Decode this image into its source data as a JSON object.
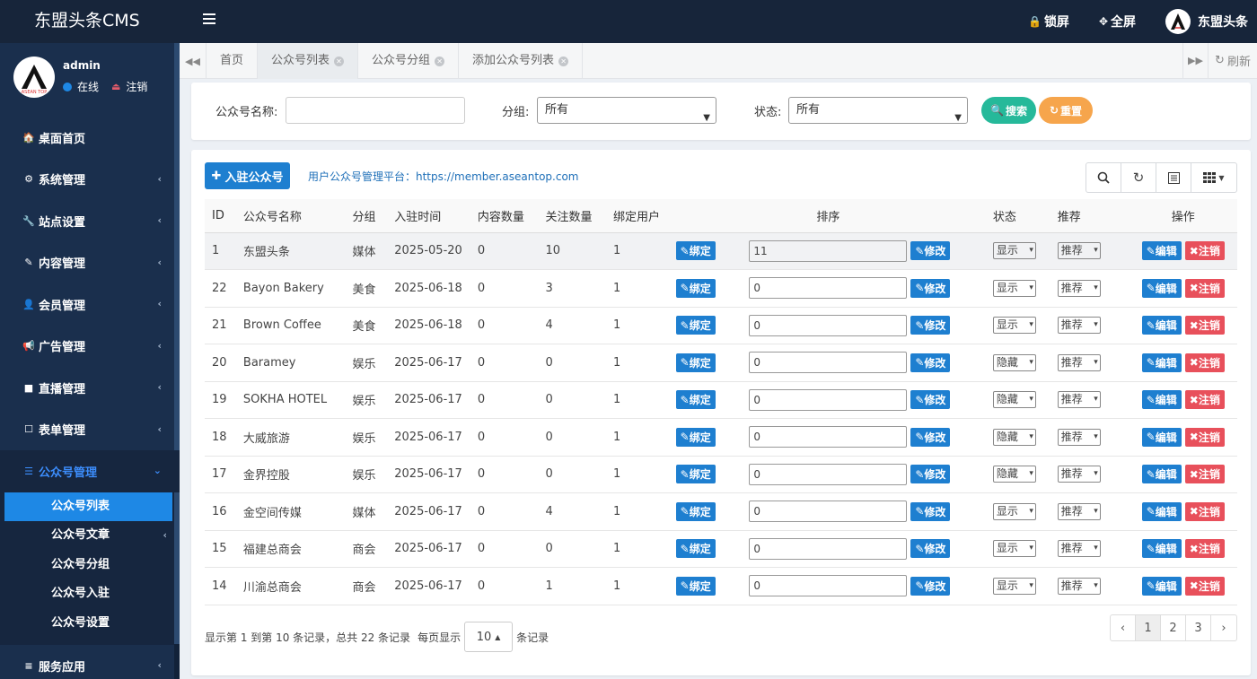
{
  "app": {
    "title": "东盟头条CMS"
  },
  "topbar": {
    "lock_label": "锁屏",
    "fullscreen_label": "全屏",
    "user_label": "东盟头条"
  },
  "user": {
    "name": "admin",
    "status": "在线",
    "logout": "注销"
  },
  "sidebar": {
    "items": [
      {
        "label": "桌面首页",
        "icon": "home-icon",
        "glyph": "🏠"
      },
      {
        "label": "系统管理",
        "icon": "gear-icon",
        "glyph": "⚙",
        "arrow": true
      },
      {
        "label": "站点设置",
        "icon": "wrench-icon",
        "glyph": "🔧",
        "arrow": true
      },
      {
        "label": "内容管理",
        "icon": "edit-icon",
        "glyph": "✎",
        "arrow": true
      },
      {
        "label": "会员管理",
        "icon": "user-icon",
        "glyph": "👤",
        "arrow": true
      },
      {
        "label": "广告管理",
        "icon": "bullhorn-icon",
        "glyph": "📢",
        "arrow": true
      },
      {
        "label": "直播管理",
        "icon": "video-icon",
        "glyph": "■",
        "arrow": true
      },
      {
        "label": "表单管理",
        "icon": "form-icon",
        "glyph": "☐",
        "arrow": true
      }
    ],
    "open_item": {
      "label": "公众号管理",
      "icon": "database-icon",
      "glyph": "☰"
    },
    "sub_items": [
      {
        "label": "公众号列表",
        "active": true
      },
      {
        "label": "公众号文章",
        "arrow": true
      },
      {
        "label": "公众号分组"
      },
      {
        "label": "公众号入驻"
      },
      {
        "label": "公众号设置"
      }
    ],
    "last_item": {
      "label": "服务应用",
      "icon": "list-icon",
      "glyph": "≡"
    }
  },
  "tabs": {
    "items": [
      {
        "label": "首页",
        "closable": false
      },
      {
        "label": "公众号列表",
        "closable": true,
        "active": true
      },
      {
        "label": "公众号分组",
        "closable": true
      },
      {
        "label": "添加公众号列表",
        "closable": true
      }
    ],
    "refresh_label": "刷新"
  },
  "filter": {
    "name_label": "公众号名称:",
    "name_value": "",
    "group_label": "分组:",
    "group_value": "所有",
    "status_label": "状态:",
    "status_value": "所有",
    "search_label": "搜索",
    "reset_label": "重置"
  },
  "panel": {
    "add_label": "入驻公众号",
    "platform_text": "用户公众号管理平台：https://member.aseantop.com"
  },
  "table": {
    "headers": [
      "ID",
      "公众号名称",
      "分组",
      "入驻时间",
      "内容数量",
      "关注数量",
      "绑定用户",
      "",
      "排序",
      "",
      "状态",
      "推荐",
      "操作"
    ],
    "bind_label": "绑定",
    "modify_label": "修改",
    "edit_label": "编辑",
    "delete_label": "注销",
    "rows": [
      {
        "id": "1",
        "name": "东盟头条",
        "group": "媒体",
        "date": "2025-05-20",
        "content": "0",
        "follow": "10",
        "bound": "1",
        "sort": "11",
        "status": "显示",
        "recommend": "推荐"
      },
      {
        "id": "22",
        "name": "Bayon Bakery",
        "group": "美食",
        "date": "2025-06-18",
        "content": "0",
        "follow": "3",
        "bound": "1",
        "sort": "0",
        "status": "显示",
        "recommend": "推荐"
      },
      {
        "id": "21",
        "name": "Brown Coffee",
        "group": "美食",
        "date": "2025-06-18",
        "content": "0",
        "follow": "4",
        "bound": "1",
        "sort": "0",
        "status": "显示",
        "recommend": "推荐"
      },
      {
        "id": "20",
        "name": "Baramey",
        "group": "娱乐",
        "date": "2025-06-17",
        "content": "0",
        "follow": "0",
        "bound": "1",
        "sort": "0",
        "status": "隐藏",
        "recommend": "推荐"
      },
      {
        "id": "19",
        "name": "SOKHA HOTEL",
        "group": "娱乐",
        "date": "2025-06-17",
        "content": "0",
        "follow": "0",
        "bound": "1",
        "sort": "0",
        "status": "隐藏",
        "recommend": "推荐"
      },
      {
        "id": "18",
        "name": "大威旅游",
        "group": "娱乐",
        "date": "2025-06-17",
        "content": "0",
        "follow": "0",
        "bound": "1",
        "sort": "0",
        "status": "隐藏",
        "recommend": "推荐"
      },
      {
        "id": "17",
        "name": "金界控股",
        "group": "娱乐",
        "date": "2025-06-17",
        "content": "0",
        "follow": "0",
        "bound": "1",
        "sort": "0",
        "status": "隐藏",
        "recommend": "推荐"
      },
      {
        "id": "16",
        "name": "金空间传媒",
        "group": "媒体",
        "date": "2025-06-17",
        "content": "0",
        "follow": "4",
        "bound": "1",
        "sort": "0",
        "status": "显示",
        "recommend": "推荐"
      },
      {
        "id": "15",
        "name": "福建总商会",
        "group": "商会",
        "date": "2025-06-17",
        "content": "0",
        "follow": "0",
        "bound": "1",
        "sort": "0",
        "status": "显示",
        "recommend": "推荐"
      },
      {
        "id": "14",
        "name": "川渝总商会",
        "group": "商会",
        "date": "2025-06-17",
        "content": "0",
        "follow": "1",
        "bound": "1",
        "sort": "0",
        "status": "显示",
        "recommend": "推荐"
      }
    ]
  },
  "pagination": {
    "info_prefix": "显示第 1 到第 10 条记录，总共 22 条记录",
    "per_page_label": "每页显示",
    "per_page_value": "10",
    "per_page_suffix": "条记录",
    "prev": "‹",
    "pages": [
      "1",
      "2",
      "3"
    ],
    "next": "›"
  },
  "colors": {
    "header_bg": "#17253a",
    "sidebar_bg": "#1a2f4d",
    "accent": "#1e7fd0",
    "danger": "#e8505b",
    "search": "#26b99a",
    "reset": "#f6a54c"
  }
}
